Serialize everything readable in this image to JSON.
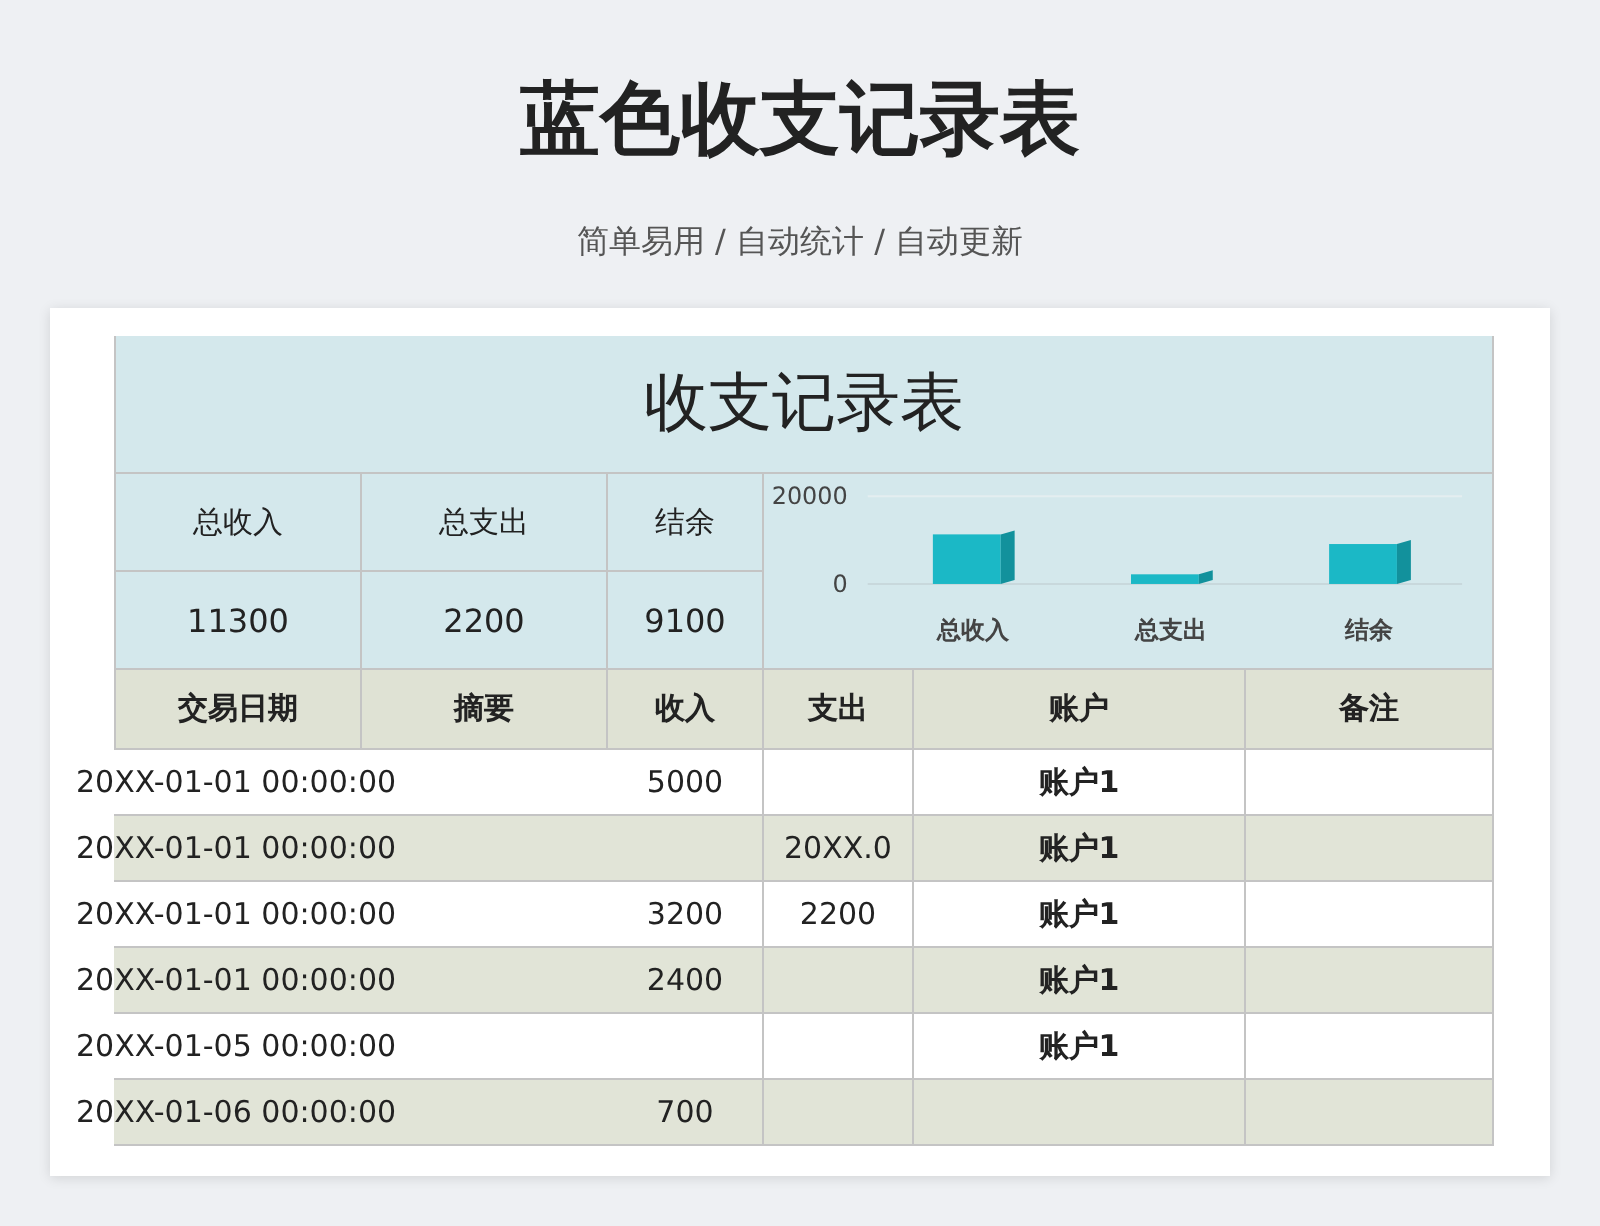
{
  "page_title": "蓝色收支记录表",
  "subtitle": "简单易用 / 自动统计 / 自动更新",
  "sheet": {
    "title": "收支记录表",
    "summary": [
      {
        "label": "总收入",
        "value": "11300"
      },
      {
        "label": "总支出",
        "value": "2200"
      },
      {
        "label": "结余",
        "value": "9100"
      }
    ],
    "chart_data": {
      "type": "bar",
      "categories": [
        "总收入",
        "总支出",
        "结余"
      ],
      "series": [
        {
          "color": "#1bb8c6",
          "values": [
            11300,
            2200,
            9100
          ]
        }
      ],
      "ylim": [
        0,
        20000
      ],
      "yticks": [
        0,
        20000
      ]
    },
    "columns": [
      "交易日期",
      "摘要",
      "收入",
      "支出",
      "账户",
      "备注"
    ],
    "rows": [
      {
        "date": "20XX-01-01 00:00:00",
        "income": "5000",
        "expense": "",
        "account": "账户1",
        "shaded": false
      },
      {
        "date": "20XX-01-01 00:00:00",
        "income": "",
        "expense": "20XX.0",
        "account": "账户1",
        "shaded": true
      },
      {
        "date": "20XX-01-01 00:00:00",
        "income": "3200",
        "expense": "2200",
        "account": "账户1",
        "shaded": false
      },
      {
        "date": "20XX-01-01 00:00:00",
        "income": "2400",
        "expense": "",
        "account": "账户1",
        "shaded": true
      },
      {
        "date": "20XX-01-05 00:00:00",
        "income": "",
        "expense": "",
        "account": "账户1",
        "shaded": false
      },
      {
        "date": "20XX-01-06 00:00:00",
        "income": "700",
        "expense": "",
        "account": "",
        "shaded": true
      }
    ]
  }
}
